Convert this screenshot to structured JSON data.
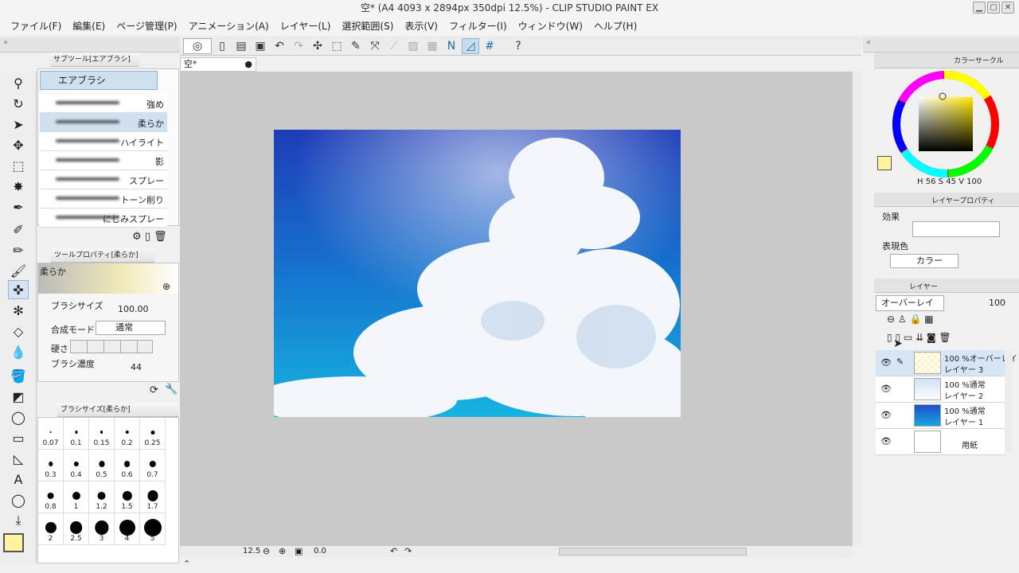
{
  "window": {
    "title": "空* (A4 4093 x 2894px 350dpi 12.5%) - CLIP STUDIO PAINT EX"
  },
  "menu": [
    "ファイル(F)",
    "編集(E)",
    "ページ管理(P)",
    "アニメーション(A)",
    "レイヤー(L)",
    "選択範囲(S)",
    "表示(V)",
    "フィルター(I)",
    "ウィンドウ(W)",
    "ヘルプ(H)"
  ],
  "subtool": {
    "title": "サブツール[エアブラシ]",
    "group": "エアブラシ",
    "items": [
      "強め",
      "柔らか",
      "ハイライト",
      "影",
      "スプレー",
      "トーン削り",
      "にじみスプレー"
    ],
    "selected": "柔らか"
  },
  "toolprop": {
    "title": "ツールプロパティ[柔らか]",
    "preview_label": "柔らか",
    "brush_size_label": "ブラシサイズ",
    "brush_size": "100.00",
    "blend_label": "合成モード",
    "blend_value": "通常",
    "hardness_label": "硬さ",
    "density_label": "ブラシ濃度",
    "density": "44"
  },
  "brushsize": {
    "title": "ブラシサイズ[柔らか]",
    "values": [
      "0.07",
      "0.1",
      "0.15",
      "0.2",
      "0.25",
      "0.3",
      "0.4",
      "0.5",
      "0.6",
      "0.7",
      "0.8",
      "1",
      "1.2",
      "1.5",
      "1.7",
      "2",
      "2.5",
      "3",
      "4",
      "5"
    ]
  },
  "canvas": {
    "tab": "空*",
    "zoom": "12.5",
    "rotation": "0.0"
  },
  "color": {
    "title": "カラーサークル",
    "h": "56",
    "s": "45",
    "v": "100",
    "h_label": "H",
    "s_label": "S",
    "v_label": "V",
    "main": "#fff3a0"
  },
  "layerprop": {
    "title": "レイヤープロパティ",
    "effect_label": "効果",
    "expr_label": "表現色",
    "expr_value": "カラー"
  },
  "layers": {
    "title": "レイヤー",
    "blend": "オーバーレイ",
    "opacity": "100",
    "rows": [
      {
        "mode": "100 %オーバーレイ",
        "name": "レイヤー 3"
      },
      {
        "mode": "100 %通常",
        "name": "レイヤー 2"
      },
      {
        "mode": "100 %通常",
        "name": "レイヤー 1"
      },
      {
        "mode": "",
        "name": "用紙"
      }
    ]
  }
}
